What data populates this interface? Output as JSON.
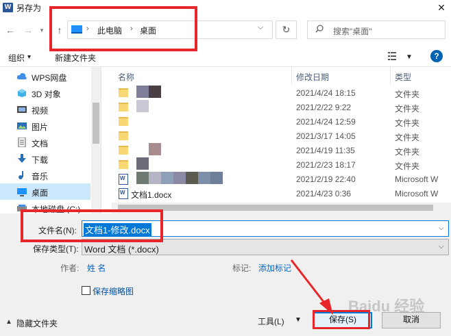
{
  "window": {
    "title": "另存为",
    "app_icon": "W",
    "close_icon": "✕"
  },
  "address": {
    "segments": [
      "此电脑",
      "桌面"
    ],
    "search_placeholder": "搜索\"桌面\""
  },
  "toolbar": {
    "organize": "组织",
    "organize_caret": "▾",
    "new_folder": "新建文件夹",
    "help": "?"
  },
  "sidebar": {
    "items": [
      {
        "label": "WPS网盘",
        "icon": "cloud-icon"
      },
      {
        "label": "3D 对象",
        "icon": "cube-icon"
      },
      {
        "label": "视频",
        "icon": "video-icon"
      },
      {
        "label": "图片",
        "icon": "picture-icon"
      },
      {
        "label": "文档",
        "icon": "document-icon"
      },
      {
        "label": "下载",
        "icon": "download-icon"
      },
      {
        "label": "音乐",
        "icon": "music-icon"
      },
      {
        "label": "桌面",
        "icon": "desktop-icon",
        "selected": true
      },
      {
        "label": "本地磁盘 (C:)",
        "icon": "drive-icon"
      }
    ]
  },
  "files": {
    "headers": {
      "name": "名称",
      "date": "修改日期",
      "type": "类型"
    },
    "rows": [
      {
        "name": "",
        "date": "2021/4/24 18:15",
        "type": "文件夹",
        "kind": "folder"
      },
      {
        "name": "",
        "date": "2021/2/22 9:22",
        "type": "文件夹",
        "kind": "folder"
      },
      {
        "name": "",
        "date": "2021/4/24 12:59",
        "type": "文件夹",
        "kind": "folder"
      },
      {
        "name": "",
        "date": "2021/3/17 14:05",
        "type": "文件夹",
        "kind": "folder"
      },
      {
        "name": "",
        "date": "2021/4/19 11:35",
        "type": "文件夹",
        "kind": "folder"
      },
      {
        "name": "",
        "date": "2021/2/23 18:17",
        "type": "文件夹",
        "kind": "folder"
      },
      {
        "name": "",
        "date": "2021/2/19 22:40",
        "type": "Microsoft W",
        "kind": "doc"
      },
      {
        "name": "文档1.docx",
        "date": "2021/4/23 0:36",
        "type": "Microsoft W",
        "kind": "doc"
      }
    ]
  },
  "form": {
    "filename_label": "文件名(N):",
    "filename_value": "文档1-修改.docx",
    "filetype_label": "保存类型(T):",
    "filetype_value": "Word 文档 (*.docx)",
    "author_label": "作者:",
    "author_value": "姓 名",
    "tags_label": "标记:",
    "tags_value": "添加标记",
    "thumbnail_label": "保存缩略图"
  },
  "footer": {
    "hide_folders": "隐藏文件夹",
    "tools": "工具(L)",
    "save": "保存(S)",
    "cancel": "取消"
  },
  "watermark": "Baidu 经验",
  "annotation_color": "#e8262a"
}
